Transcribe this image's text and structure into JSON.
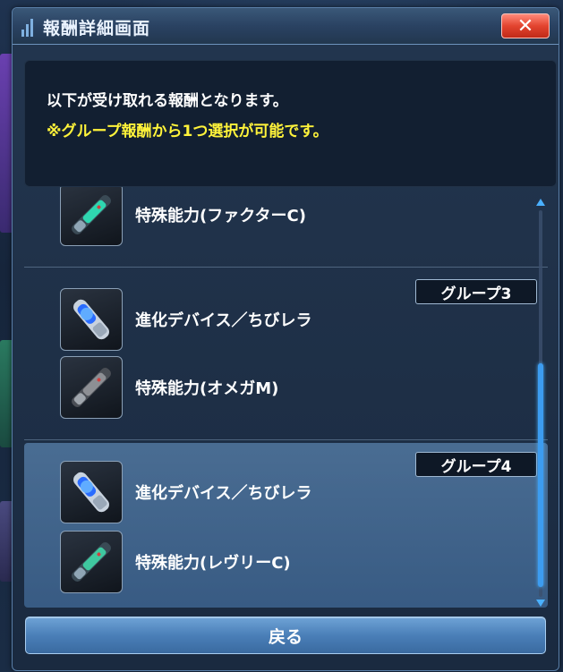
{
  "window": {
    "title": "報酬詳細画面",
    "close_label": "✕"
  },
  "notice": {
    "line1": "以下が受け取れる報酬となります。",
    "line2": "※グループ報酬から1つ選択が可能です。"
  },
  "groups": [
    {
      "badge": "",
      "items": [
        {
          "label": "特殊能力(ファクターC)",
          "icon": "factor-capsule-icon"
        }
      ]
    },
    {
      "badge": "グループ3",
      "items": [
        {
          "label": "進化デバイス／ちびレラ",
          "icon": "evolution-device-icon"
        },
        {
          "label": "特殊能力(オメガM)",
          "icon": "omega-capsule-icon"
        }
      ]
    },
    {
      "badge": "グループ4",
      "items": [
        {
          "label": "進化デバイス／ちびレラ",
          "icon": "evolution-device-icon"
        },
        {
          "label": "特殊能力(レヴリーC)",
          "icon": "revery-capsule-icon"
        }
      ]
    }
  ],
  "footer": {
    "back_label": "戻る"
  },
  "colors": {
    "highlight_text": "#fff33a",
    "close_button": "#e3442f",
    "accent_blue": "#3c9cf0"
  }
}
